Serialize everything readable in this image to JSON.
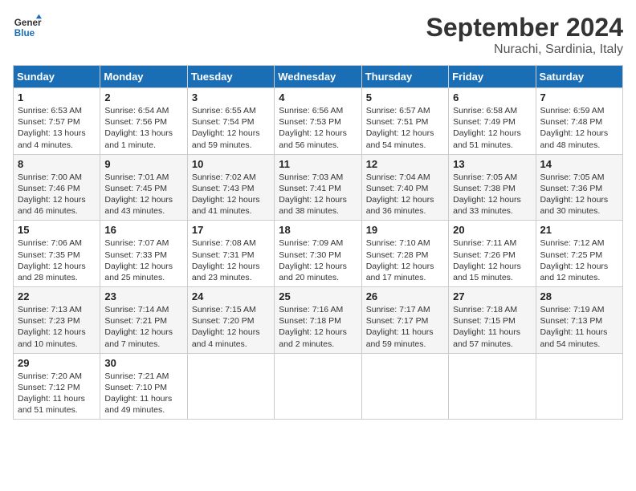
{
  "header": {
    "logo_line1": "General",
    "logo_line2": "Blue",
    "month": "September 2024",
    "location": "Nurachi, Sardinia, Italy"
  },
  "days_of_week": [
    "Sunday",
    "Monday",
    "Tuesday",
    "Wednesday",
    "Thursday",
    "Friday",
    "Saturday"
  ],
  "weeks": [
    [
      {
        "day": "1",
        "info": "Sunrise: 6:53 AM\nSunset: 7:57 PM\nDaylight: 13 hours\nand 4 minutes."
      },
      {
        "day": "2",
        "info": "Sunrise: 6:54 AM\nSunset: 7:56 PM\nDaylight: 13 hours\nand 1 minute."
      },
      {
        "day": "3",
        "info": "Sunrise: 6:55 AM\nSunset: 7:54 PM\nDaylight: 12 hours\nand 59 minutes."
      },
      {
        "day": "4",
        "info": "Sunrise: 6:56 AM\nSunset: 7:53 PM\nDaylight: 12 hours\nand 56 minutes."
      },
      {
        "day": "5",
        "info": "Sunrise: 6:57 AM\nSunset: 7:51 PM\nDaylight: 12 hours\nand 54 minutes."
      },
      {
        "day": "6",
        "info": "Sunrise: 6:58 AM\nSunset: 7:49 PM\nDaylight: 12 hours\nand 51 minutes."
      },
      {
        "day": "7",
        "info": "Sunrise: 6:59 AM\nSunset: 7:48 PM\nDaylight: 12 hours\nand 48 minutes."
      }
    ],
    [
      {
        "day": "8",
        "info": "Sunrise: 7:00 AM\nSunset: 7:46 PM\nDaylight: 12 hours\nand 46 minutes."
      },
      {
        "day": "9",
        "info": "Sunrise: 7:01 AM\nSunset: 7:45 PM\nDaylight: 12 hours\nand 43 minutes."
      },
      {
        "day": "10",
        "info": "Sunrise: 7:02 AM\nSunset: 7:43 PM\nDaylight: 12 hours\nand 41 minutes."
      },
      {
        "day": "11",
        "info": "Sunrise: 7:03 AM\nSunset: 7:41 PM\nDaylight: 12 hours\nand 38 minutes."
      },
      {
        "day": "12",
        "info": "Sunrise: 7:04 AM\nSunset: 7:40 PM\nDaylight: 12 hours\nand 36 minutes."
      },
      {
        "day": "13",
        "info": "Sunrise: 7:05 AM\nSunset: 7:38 PM\nDaylight: 12 hours\nand 33 minutes."
      },
      {
        "day": "14",
        "info": "Sunrise: 7:05 AM\nSunset: 7:36 PM\nDaylight: 12 hours\nand 30 minutes."
      }
    ],
    [
      {
        "day": "15",
        "info": "Sunrise: 7:06 AM\nSunset: 7:35 PM\nDaylight: 12 hours\nand 28 minutes."
      },
      {
        "day": "16",
        "info": "Sunrise: 7:07 AM\nSunset: 7:33 PM\nDaylight: 12 hours\nand 25 minutes."
      },
      {
        "day": "17",
        "info": "Sunrise: 7:08 AM\nSunset: 7:31 PM\nDaylight: 12 hours\nand 23 minutes."
      },
      {
        "day": "18",
        "info": "Sunrise: 7:09 AM\nSunset: 7:30 PM\nDaylight: 12 hours\nand 20 minutes."
      },
      {
        "day": "19",
        "info": "Sunrise: 7:10 AM\nSunset: 7:28 PM\nDaylight: 12 hours\nand 17 minutes."
      },
      {
        "day": "20",
        "info": "Sunrise: 7:11 AM\nSunset: 7:26 PM\nDaylight: 12 hours\nand 15 minutes."
      },
      {
        "day": "21",
        "info": "Sunrise: 7:12 AM\nSunset: 7:25 PM\nDaylight: 12 hours\nand 12 minutes."
      }
    ],
    [
      {
        "day": "22",
        "info": "Sunrise: 7:13 AM\nSunset: 7:23 PM\nDaylight: 12 hours\nand 10 minutes."
      },
      {
        "day": "23",
        "info": "Sunrise: 7:14 AM\nSunset: 7:21 PM\nDaylight: 12 hours\nand 7 minutes."
      },
      {
        "day": "24",
        "info": "Sunrise: 7:15 AM\nSunset: 7:20 PM\nDaylight: 12 hours\nand 4 minutes."
      },
      {
        "day": "25",
        "info": "Sunrise: 7:16 AM\nSunset: 7:18 PM\nDaylight: 12 hours\nand 2 minutes."
      },
      {
        "day": "26",
        "info": "Sunrise: 7:17 AM\nSunset: 7:17 PM\nDaylight: 11 hours\nand 59 minutes."
      },
      {
        "day": "27",
        "info": "Sunrise: 7:18 AM\nSunset: 7:15 PM\nDaylight: 11 hours\nand 57 minutes."
      },
      {
        "day": "28",
        "info": "Sunrise: 7:19 AM\nSunset: 7:13 PM\nDaylight: 11 hours\nand 54 minutes."
      }
    ],
    [
      {
        "day": "29",
        "info": "Sunrise: 7:20 AM\nSunset: 7:12 PM\nDaylight: 11 hours\nand 51 minutes."
      },
      {
        "day": "30",
        "info": "Sunrise: 7:21 AM\nSunset: 7:10 PM\nDaylight: 11 hours\nand 49 minutes."
      },
      {
        "day": "",
        "info": ""
      },
      {
        "day": "",
        "info": ""
      },
      {
        "day": "",
        "info": ""
      },
      {
        "day": "",
        "info": ""
      },
      {
        "day": "",
        "info": ""
      }
    ]
  ]
}
